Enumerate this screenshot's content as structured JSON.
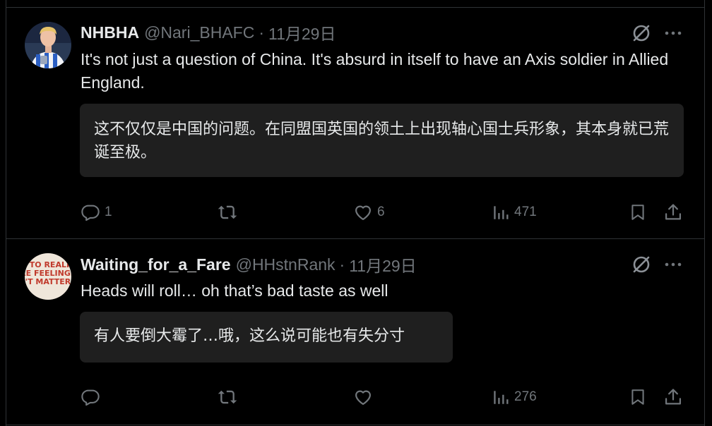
{
  "tweets": [
    {
      "author_name": "NHBHA",
      "handle": "@Nari_BHAFC",
      "separator": "·",
      "date": "11月29日",
      "text": "It's not just a question of China. It's absurd in itself to have an Axis soldier in Allied England.",
      "translation": "这不仅仅是中国的问题。在同盟国英国的领土上出现轴心国士兵形象，其本身就已荒诞至极。",
      "actions": {
        "replies": "1",
        "retweets": "",
        "likes": "6",
        "views": "471"
      },
      "avatar": {
        "icon": "avatar-football-player"
      }
    },
    {
      "author_name": "Waiting_for_a_Fare",
      "handle": "@HHstnRank",
      "separator": "·",
      "date": "11月29日",
      "text": "Heads will roll… oh that’s bad taste as well",
      "translation": "有人要倒大霉了…哦，这么说可能也有失分寸",
      "actions": {
        "replies": "",
        "retweets": "",
        "likes": "",
        "views": "276"
      },
      "avatar": {
        "icon": "avatar-text-sign",
        "sign_lines": [
          "E TO REALIT",
          "RE FEELINGS",
          "'T MATTER"
        ]
      }
    }
  ],
  "icons": {
    "translate": "translate-slash-icon",
    "more": "more-icon",
    "reply": "reply-icon",
    "retweet": "retweet-icon",
    "like": "heart-icon",
    "views": "views-icon",
    "bookmark": "bookmark-icon",
    "share": "share-icon"
  },
  "colors": {
    "background": "#000000",
    "text": "#e7e9ea",
    "muted": "#71767b",
    "border": "#2f3336",
    "translation_bg": "#1f1f1f"
  }
}
